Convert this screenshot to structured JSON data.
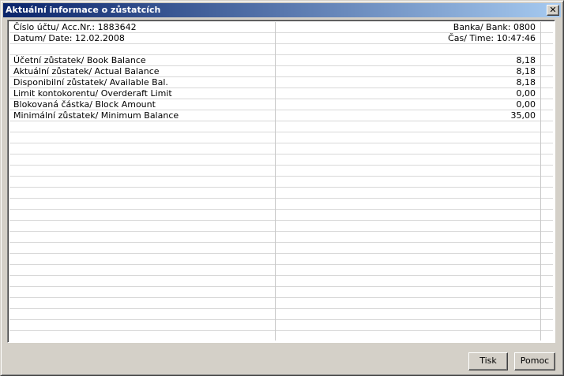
{
  "window": {
    "title": "Aktuální informace o zůstatcích",
    "close_glyph": "✕"
  },
  "header": {
    "account_label": "Číslo účtu/ Acc.Nr.: 1883642",
    "bank_label": "Banka/ Bank: 0800",
    "date_label": "Datum/ Date: 12.02.2008",
    "time_label": "Čas/ Time: 10:47:46"
  },
  "balances": [
    {
      "label": "Účetní zůstatek/ Book Balance",
      "value": "8,18"
    },
    {
      "label": "Aktuální zůstatek/ Actual Balance",
      "value": "8,18"
    },
    {
      "label": "Disponibilní zůstatek/ Available Bal.",
      "value": "8,18"
    },
    {
      "label": "Limit kontokorentu/ Overderaft Limit",
      "value": "0,00"
    },
    {
      "label": "Blokovaná částka/ Block Amount",
      "value": "0,00"
    },
    {
      "label": "Minimální zůstatek/ Minimum Balance",
      "value": "35,00"
    }
  ],
  "buttons": {
    "print_label": "Tisk",
    "help_label": "Pomoc"
  },
  "colors": {
    "titlebar_start": "#0a246a",
    "titlebar_end": "#a6caf0",
    "face": "#d4d0c8"
  }
}
